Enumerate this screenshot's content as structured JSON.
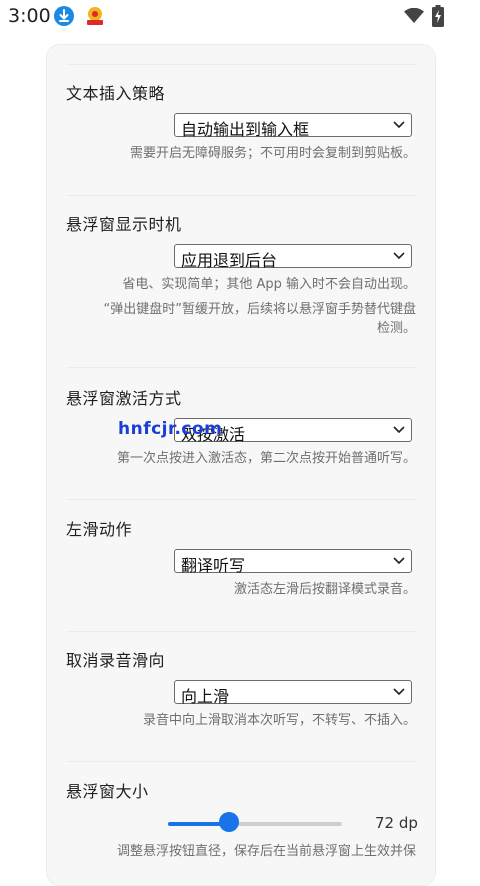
{
  "status_bar": {
    "time": "3:00",
    "icons": [
      "download-icon",
      "app-badge-icon",
      "wifi-icon",
      "battery-charging-icon"
    ]
  },
  "sections": [
    {
      "title": "文本插入策略",
      "selected": "自动输出到输入框",
      "desc": [
        "需要开启无障碍服务；不可用时会复制到剪贴板。"
      ]
    },
    {
      "title": "悬浮窗显示时机",
      "selected": "应用退到后台",
      "desc": [
        "省电、实现简单；其他 App 输入时不会自动出现。",
        "“弹出键盘时”暂缓开放，后续将以悬浮窗手势替代键盘",
        "检测。"
      ]
    },
    {
      "title": "悬浮窗激活方式",
      "selected": "双按激活",
      "desc": [
        "第一次点按进入激活态，第二次点按开始普通听写。"
      ]
    },
    {
      "title": "左滑动作",
      "selected": "翻译听写",
      "desc": [
        "激活态左滑后按翻译模式录音。"
      ]
    },
    {
      "title": "取消录音滑向",
      "selected": "向上滑",
      "desc": [
        "录音中向上滑取消本次听写，不转写、不插入。"
      ]
    },
    {
      "title": "悬浮窗大小",
      "slider_value": "72 dp",
      "slider_fraction": 0.35,
      "desc": [
        "调整悬浮按钮直径，保存后在当前悬浮窗上生效并保"
      ]
    }
  ],
  "watermark": "hnfcjr.com",
  "colors": {
    "accent": "#1a73e8",
    "card_bg": "#f7f7f7",
    "desc_text": "#6f6f6f"
  }
}
